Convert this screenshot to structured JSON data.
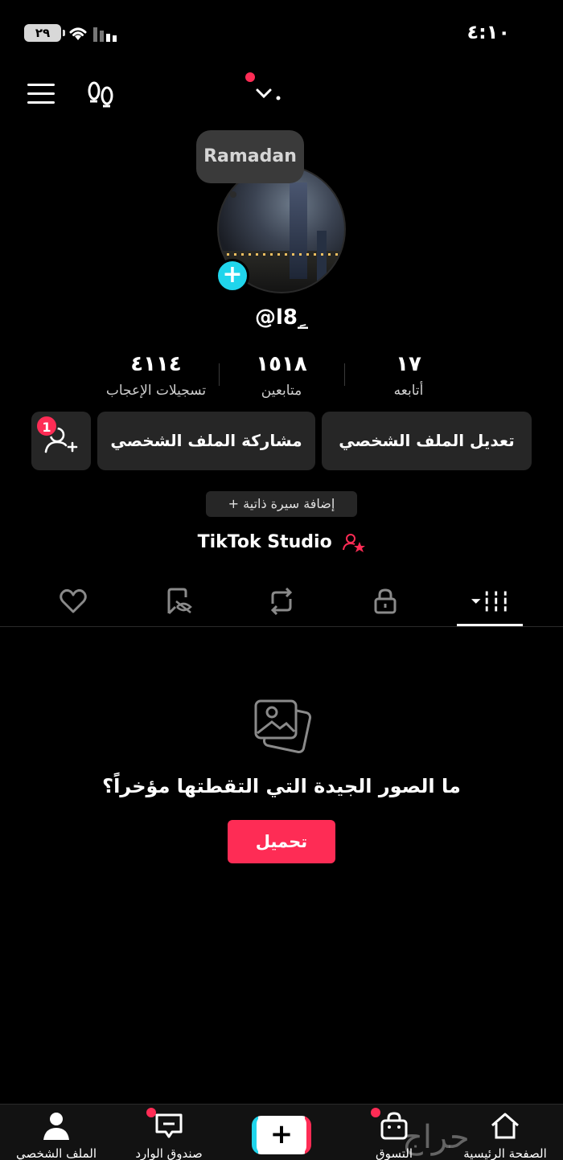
{
  "status_bar": {
    "battery": "٢٩",
    "time": "٤:١٠"
  },
  "header": {
    "story_label": "Ramadan"
  },
  "profile": {
    "username": "@l8ِ_"
  },
  "stats": [
    {
      "value": "١٧",
      "label": "أتابعه"
    },
    {
      "value": "١٥١٨",
      "label": "متابعين"
    },
    {
      "value": "٤١١٤",
      "label": "تسجيلات الإعجاب"
    }
  ],
  "actions": {
    "edit_profile": "تعديل الملف الشخصي",
    "share_profile": "مشاركة الملف الشخصي",
    "friend_requests_badge": "1",
    "add_bio": "+ إضافة سيرة ذاتية",
    "studio_link": "TikTok Studio"
  },
  "tabs": [
    "videos-grid",
    "private",
    "reposts",
    "hidden-likes",
    "liked"
  ],
  "empty_state": {
    "message": "ما الصور الجيدة التي التقطتها مؤخراً؟",
    "upload_label": "تحميل"
  },
  "bottom_nav": {
    "home": "الصفحة الرئيسية",
    "shop": "التسوق",
    "inbox": "صندوق الوارد",
    "profile": "الملف الشخصي"
  },
  "watermark": "حراج",
  "colors": {
    "accent": "#fe2c55",
    "cyan": "#20d5ec",
    "button_bg": "#262626",
    "background": "#000000"
  }
}
